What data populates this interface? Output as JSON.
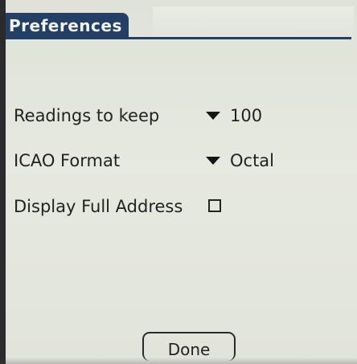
{
  "window": {
    "title": "Preferences"
  },
  "settings": {
    "readings_to_keep": {
      "label": "Readings to keep",
      "value": "100"
    },
    "icao_format": {
      "label": "ICAO Format",
      "value": "Octal"
    },
    "display_full_address": {
      "label": "Display Full Address",
      "checked": false
    }
  },
  "buttons": {
    "done_label": "Done"
  },
  "colors": {
    "title_bar": "#243f66",
    "background": "#e3e6dc",
    "text": "#222224"
  },
  "icons": {
    "popup_trigger": "triangle-down-icon",
    "checkbox": "checkbox-unchecked-icon"
  }
}
